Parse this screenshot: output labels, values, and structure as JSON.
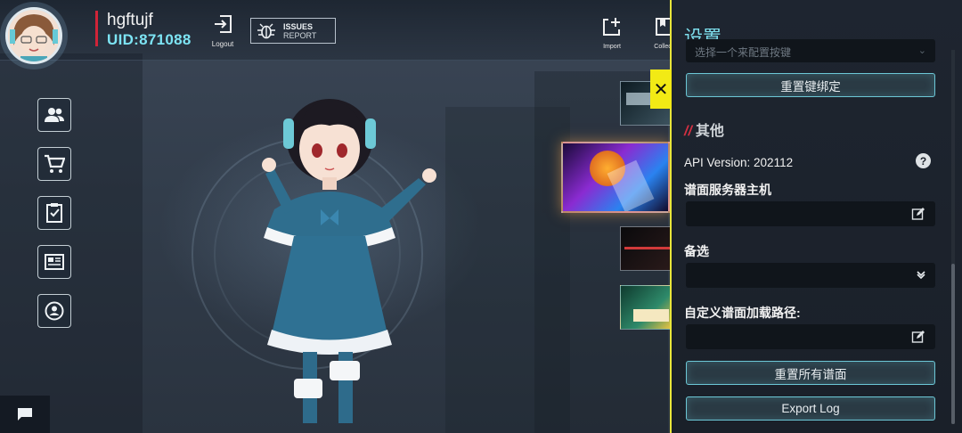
{
  "user": {
    "name": "hgftujf",
    "uid": "UID:871088"
  },
  "topbar": {
    "logout_label": "Logout",
    "issues_line1": "ISSUES",
    "issues_line2": "REPORT",
    "import_label": "Import",
    "collect_label": "Collect"
  },
  "nav": {
    "items": [
      {
        "name": "friends",
        "icon": "people-icon"
      },
      {
        "name": "store",
        "icon": "cart-icon"
      },
      {
        "name": "tasks",
        "icon": "checklist-icon"
      },
      {
        "name": "news",
        "icon": "news-icon"
      },
      {
        "name": "profile",
        "icon": "user-circle-icon"
      }
    ]
  },
  "settings": {
    "title": "设置",
    "key_select_placeholder": "选择一个来配置按键",
    "reset_keybind_label": "重置键绑定",
    "other_section_title": "其他",
    "api_version": "API Version: 202112",
    "server_host_label": "谱面服务器主机",
    "server_host_value": "",
    "alternate_label": "备选",
    "alternate_value": "",
    "custom_path_label": "自定义谱面加载路径:",
    "custom_path_value": "",
    "reset_all_label": "重置所有谱面",
    "export_log_label": "Export Log"
  },
  "colors": {
    "accent_cyan": "#7ee0ee",
    "accent_yellow": "#e9e63a",
    "accent_red": "#d43042"
  }
}
